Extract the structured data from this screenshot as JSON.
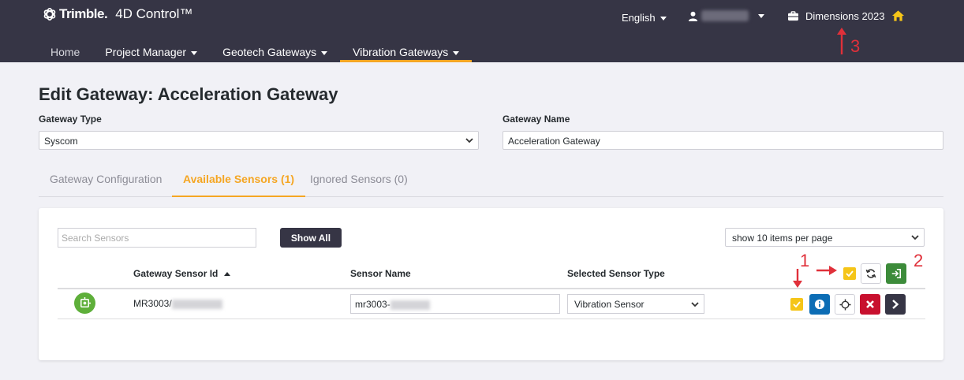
{
  "header": {
    "brand": "Trimble.",
    "product": "4D Control™",
    "language": "English",
    "project": "Dimensions 2023"
  },
  "nav": [
    {
      "label": "Home"
    },
    {
      "label": "Project Manager"
    },
    {
      "label": "Geotech Gateways"
    },
    {
      "label": "Vibration Gateways"
    }
  ],
  "page": {
    "title": "Edit Gateway: Acceleration Gateway",
    "gateway_type_label": "Gateway Type",
    "gateway_type_value": "Syscom",
    "gateway_name_label": "Gateway Name",
    "gateway_name_value": "Acceleration Gateway"
  },
  "tabs": [
    {
      "label": "Gateway Configuration"
    },
    {
      "label": "Available Sensors (1)"
    },
    {
      "label": "Ignored Sensors (0)"
    }
  ],
  "toolbar": {
    "search_placeholder": "Search Sensors",
    "show_all": "Show All",
    "per_page": "show 10 items per page"
  },
  "table": {
    "columns": [
      "Gateway Sensor Id",
      "Sensor Name",
      "Selected Sensor Type"
    ],
    "rows": [
      {
        "sensor_id": "MR3003/",
        "sensor_name": "mr3003-",
        "sensor_type": "Vibration Sensor"
      }
    ]
  },
  "annotations": [
    "1",
    "2",
    "3"
  ],
  "colors": {
    "header_bg": "#363545",
    "accent": "#f5a623",
    "checkbox": "#f5c518",
    "annotation": "#e0303a"
  }
}
